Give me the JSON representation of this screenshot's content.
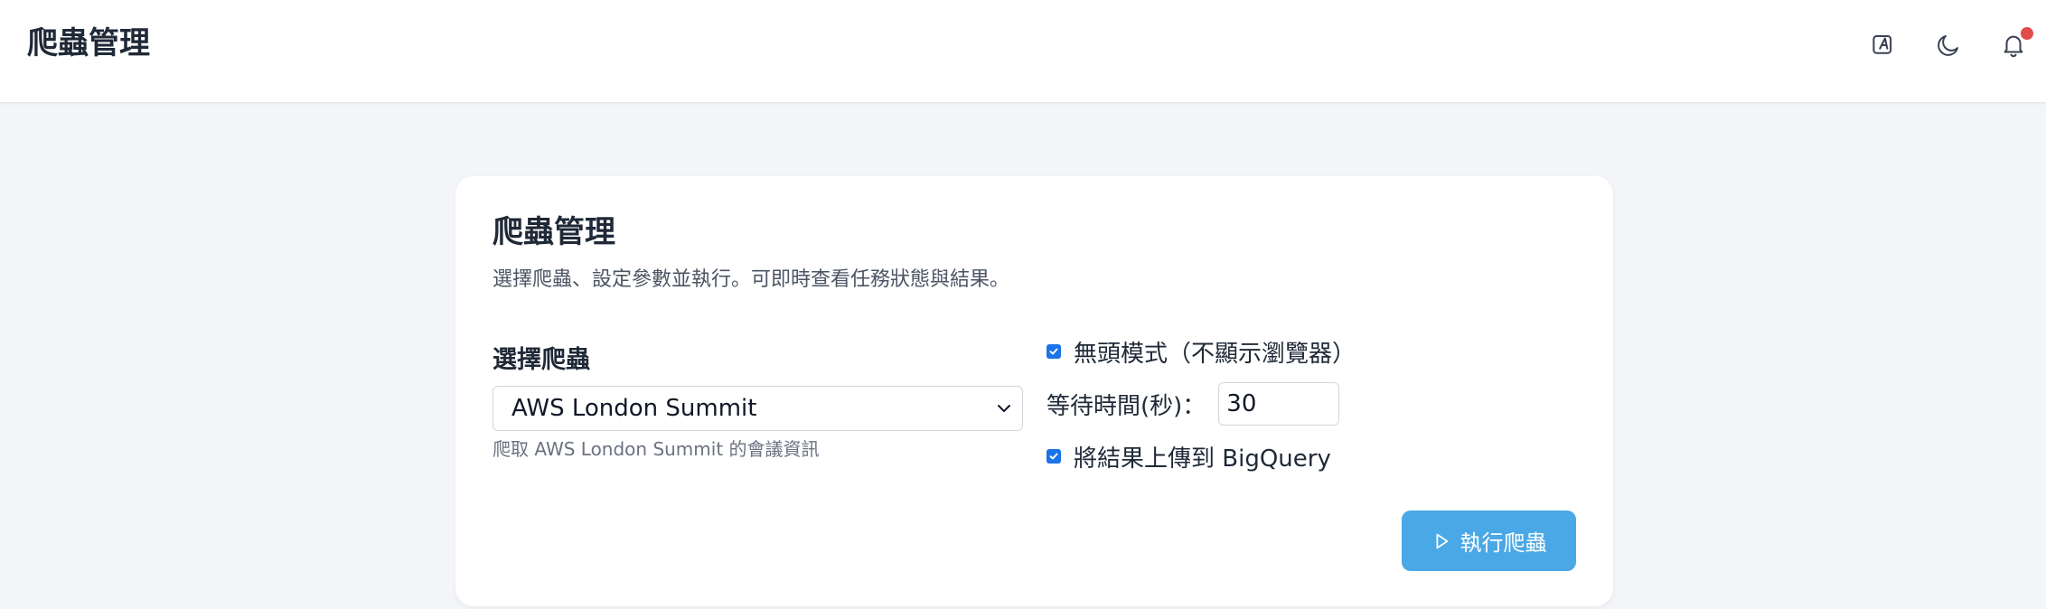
{
  "header": {
    "title": "爬蟲管理",
    "icons": [
      "edit-icon",
      "moon-icon",
      "bell-icon"
    ]
  },
  "card": {
    "title": "爬蟲管理",
    "subtitle": "選擇爬蟲、設定參數並執行。可即時查看任務狀態與結果。",
    "crawler_label": "選擇爬蟲",
    "crawler_selected": "AWS London Summit",
    "crawler_hint": "爬取 AWS London Summit 的會議資訊",
    "headless_label": "無頭模式（不顯示瀏覽器）",
    "headless_checked": true,
    "wait_label": "等待時間(秒)：",
    "wait_value": "30",
    "bigquery_label": "將結果上傳到 BigQuery",
    "bigquery_checked": true,
    "run_label": "執行爬蟲"
  },
  "colors": {
    "accent": "#4aa8e6",
    "checkbox": "#1a73e8",
    "notification": "#e24b4b"
  }
}
